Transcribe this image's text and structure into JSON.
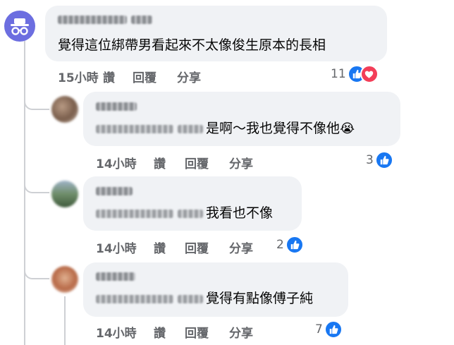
{
  "comments": [
    {
      "text": "覺得這位綁帶男看起來不太像俊生原本的長相",
      "time": "15小時",
      "like_label": "讚",
      "reply_label": "回覆",
      "share_label": "分享",
      "reaction_count": "11",
      "reactions": [
        "like-icon",
        "love-icon"
      ]
    },
    {
      "text": "是啊～我也覺得不像他",
      "emoji": "😭",
      "time": "14小時",
      "like_label": "讚",
      "reply_label": "回覆",
      "share_label": "分享",
      "reaction_count": "3",
      "reactions": [
        "like-icon"
      ]
    },
    {
      "text": "我看也不像",
      "time": "14小時",
      "like_label": "讚",
      "reply_label": "回覆",
      "share_label": "分享",
      "reaction_count": "2",
      "reactions": [
        "like-icon"
      ]
    },
    {
      "text": "覺得有點像傅子純",
      "time": "14小時",
      "like_label": "讚",
      "reply_label": "回覆",
      "share_label": "分享",
      "reaction_count": "7",
      "reactions": [
        "like-icon"
      ]
    }
  ],
  "colors": {
    "like": "#1877f2",
    "love": "#f33e58",
    "meta": "#65676b",
    "bubble": "#f0f2f5",
    "anon_avatar": "#6c6ee0"
  }
}
